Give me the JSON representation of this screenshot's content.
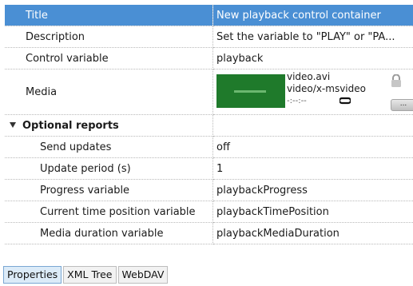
{
  "properties": {
    "header": {
      "key": "Title",
      "value": "New playback control container"
    },
    "rows": [
      {
        "key": "Description",
        "value": "Set the variable to \"PLAY\" or \"PA..."
      },
      {
        "key": "Control variable",
        "value": "playback"
      }
    ],
    "media": {
      "key": "Media",
      "file": "video.avi",
      "mime": "video/x-msvideo",
      "time": "-:--:--",
      "more_button": "..."
    },
    "optional_section": {
      "label": "Optional reports"
    },
    "optional_rows": [
      {
        "key": "Send updates",
        "value": "off"
      },
      {
        "key": "Update period (s)",
        "value": "1"
      },
      {
        "key": "Progress variable",
        "value": "playbackProgress"
      },
      {
        "key": "Current time position variable",
        "value": "playbackTimePosition"
      },
      {
        "key": "Media duration variable",
        "value": "playbackMediaDuration"
      }
    ]
  },
  "tabs": [
    {
      "label": "Properties",
      "active": true
    },
    {
      "label": "XML Tree",
      "active": false
    },
    {
      "label": "WebDAV",
      "active": false
    }
  ],
  "colors": {
    "header_bg": "#4a8fd4",
    "thumb_bg": "#1f7a2b",
    "tab_active": "#dcebf8"
  }
}
